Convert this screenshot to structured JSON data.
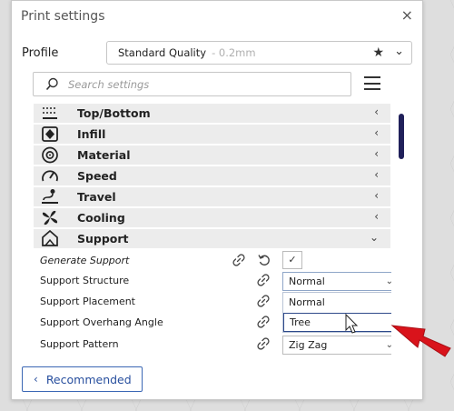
{
  "window": {
    "title": "Print settings",
    "close_glyph": "×"
  },
  "profile": {
    "label": "Profile",
    "name": "Standard Quality",
    "layer_height": "- 0.2mm",
    "star_glyph": "★",
    "chevron_glyph": "⌄"
  },
  "search": {
    "placeholder": "Search settings"
  },
  "categories": [
    {
      "label": "Top/Bottom",
      "icon": "top-bottom-icon",
      "chevron": "‹"
    },
    {
      "label": "Infill",
      "icon": "infill-icon",
      "chevron": "‹"
    },
    {
      "label": "Material",
      "icon": "material-icon",
      "chevron": "‹"
    },
    {
      "label": "Speed",
      "icon": "speed-icon",
      "chevron": "‹"
    },
    {
      "label": "Travel",
      "icon": "travel-icon",
      "chevron": "‹"
    },
    {
      "label": "Cooling",
      "icon": "cooling-icon",
      "chevron": "‹"
    },
    {
      "label": "Support",
      "icon": "support-icon",
      "chevron": "⌄"
    }
  ],
  "support_settings": [
    {
      "label": "Generate Support",
      "value": "✓",
      "control": "checkbox"
    },
    {
      "label": "Support Structure",
      "value": "Normal",
      "control": "dropdown-open"
    },
    {
      "label": "Support Placement",
      "value": "",
      "control": "hidden"
    },
    {
      "label": "Support Overhang Angle",
      "value": "",
      "control": "hidden"
    },
    {
      "label": "Support Pattern",
      "value": "Zig Zag",
      "control": "dropdown"
    }
  ],
  "structure_options": [
    "Normal",
    "Tree"
  ],
  "dropdown_chevron": "⌄",
  "recommended_button": {
    "label": "Recommended",
    "chevron": "‹"
  },
  "colors": {
    "accent_blue": "#284f9e",
    "scrollbar": "#20205a",
    "annotation_arrow": "#d9131b"
  }
}
